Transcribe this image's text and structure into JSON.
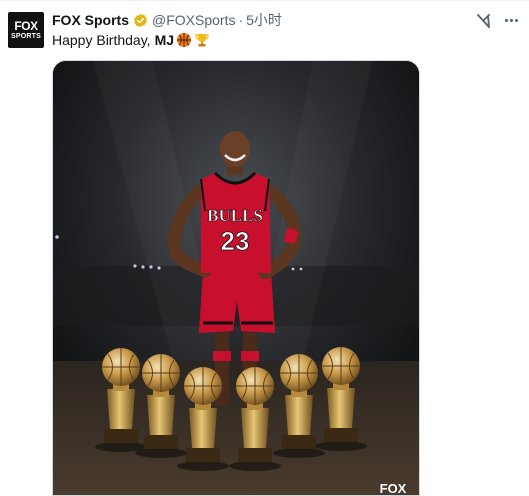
{
  "tweet": {
    "author_name": "FOX Sports",
    "handle": "@FOXSports",
    "separator": "·",
    "time": "5小时",
    "text_prefix": "Happy Birthday,",
    "text_bold": "MJ",
    "emojis": [
      "basketball-emoji",
      "trophy-emoji"
    ]
  },
  "avatar": {
    "line1": "FOX",
    "line2": "SPORTS"
  },
  "image": {
    "jersey_team": "BULLS",
    "jersey_number": "23",
    "watermark": "FOX",
    "trophy_count": 6
  },
  "colors": {
    "verified_badge": "#e2b719",
    "jersey_red": "#c8102e",
    "text_secondary": "#536471"
  }
}
